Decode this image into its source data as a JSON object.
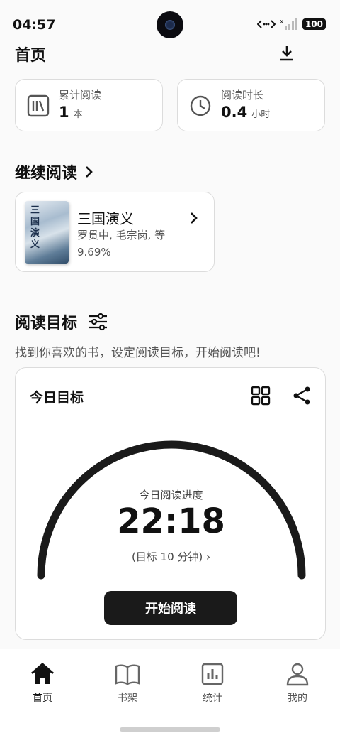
{
  "status": {
    "time": "04:57",
    "battery": "100"
  },
  "header": {
    "title": "首页"
  },
  "stats": [
    {
      "label": "累计阅读",
      "value": "1",
      "unit": "本"
    },
    {
      "label": "阅读时长",
      "value": "0.4",
      "unit": "小时"
    }
  ],
  "continue_reading": {
    "title": "继续阅读",
    "book": {
      "cover_text": "三国演义",
      "name": "三国演义",
      "author": "罗贯中, 毛宗岗, 等",
      "progress": "9.69%"
    }
  },
  "reading_goal": {
    "title": "阅读目标",
    "description": "找到你喜欢的书，设定阅读目标，开始阅读吧!",
    "card": {
      "title": "今日目标",
      "progress_label": "今日阅读进度",
      "progress_time": "22:18",
      "target_text": "(目标 10 分钟) ›",
      "start_button": "开始阅读"
    }
  },
  "tabs": [
    {
      "label": "首页",
      "icon": "home-icon",
      "active": true
    },
    {
      "label": "书架",
      "icon": "book-icon",
      "active": false
    },
    {
      "label": "统计",
      "icon": "chart-icon",
      "active": false
    },
    {
      "label": "我的",
      "icon": "user-icon",
      "active": false
    }
  ]
}
